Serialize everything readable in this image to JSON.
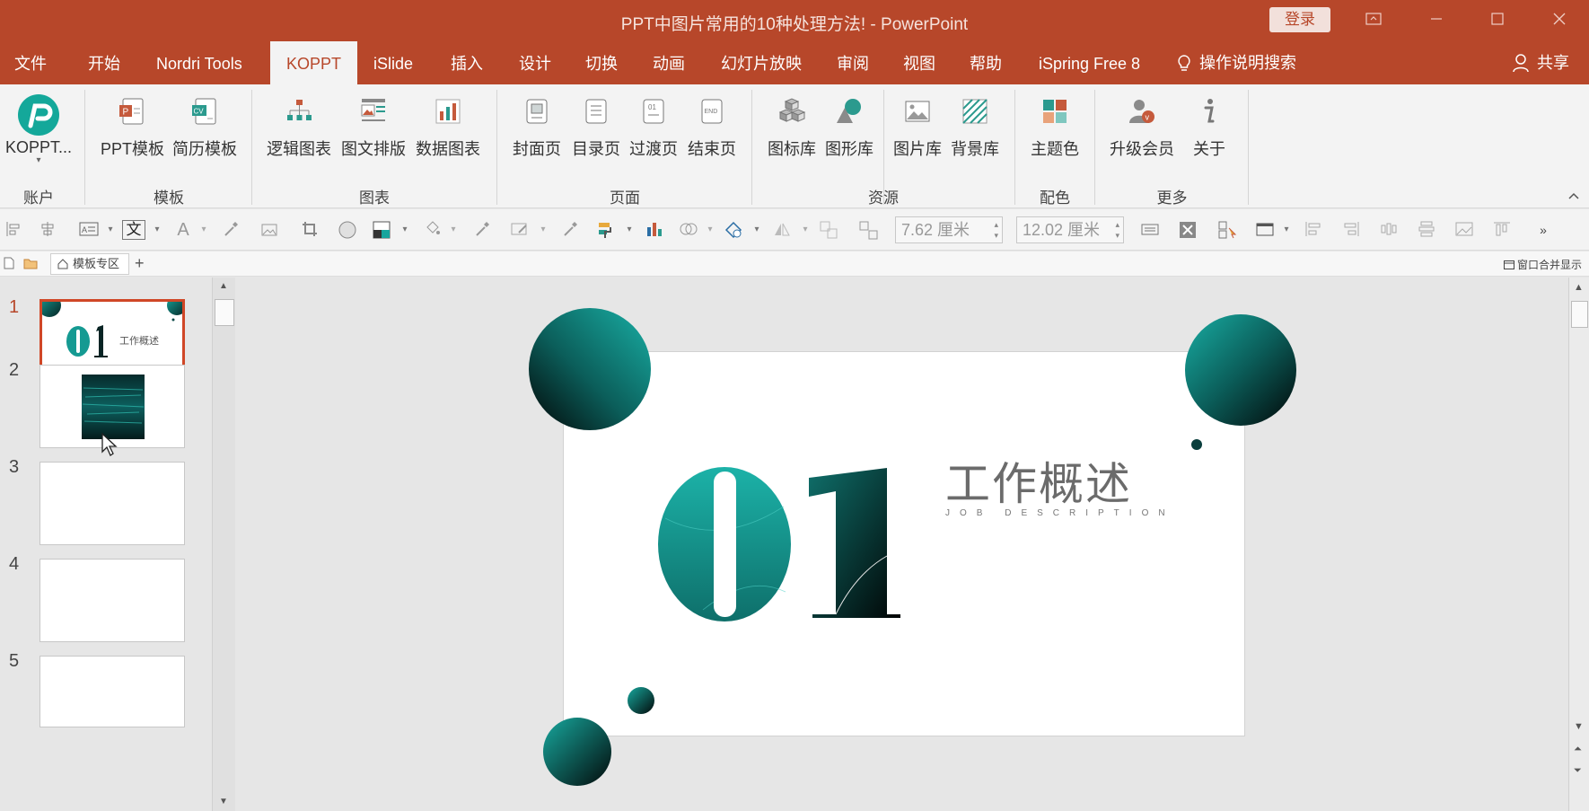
{
  "window": {
    "title": "PPT中图片常用的10种处理方法!  -  PowerPoint",
    "login_label": "登录"
  },
  "tabs": [
    {
      "label": "文件"
    },
    {
      "label": "开始"
    },
    {
      "label": "Nordri Tools"
    },
    {
      "label": "KOPPT",
      "active": true
    },
    {
      "label": "iSlide"
    },
    {
      "label": "插入"
    },
    {
      "label": "设计"
    },
    {
      "label": "切换"
    },
    {
      "label": "动画"
    },
    {
      "label": "幻灯片放映"
    },
    {
      "label": "审阅"
    },
    {
      "label": "视图"
    },
    {
      "label": "帮助"
    },
    {
      "label": "iSpring Free 8"
    }
  ],
  "search_label": "操作说明搜索",
  "share_label": "共享",
  "ribbon": {
    "buttons": [
      {
        "label": "KOPPT...",
        "icon": "koppt-logo-icon"
      },
      {
        "label": "PPT模板",
        "icon": "ppt-template-icon"
      },
      {
        "label": "简历模板",
        "icon": "cv-template-icon"
      },
      {
        "label": "逻辑图表",
        "icon": "logic-chart-icon"
      },
      {
        "label": "图文排版",
        "icon": "layout-icon"
      },
      {
        "label": "数据图表",
        "icon": "data-chart-icon"
      },
      {
        "label": "封面页",
        "icon": "cover-page-icon"
      },
      {
        "label": "目录页",
        "icon": "toc-page-icon"
      },
      {
        "label": "过渡页",
        "icon": "transition-page-icon"
      },
      {
        "label": "结束页",
        "icon": "end-page-icon"
      },
      {
        "label": "图标库",
        "icon": "icon-library-icon"
      },
      {
        "label": "图形库",
        "icon": "shape-library-icon"
      },
      {
        "label": "图片库",
        "icon": "picture-library-icon"
      },
      {
        "label": "背景库",
        "icon": "background-library-icon"
      },
      {
        "label": "主题色",
        "icon": "theme-color-icon"
      },
      {
        "label": "升级会员",
        "icon": "vip-icon"
      },
      {
        "label": "关于",
        "icon": "info-icon"
      }
    ],
    "groups": [
      "账户",
      "模板",
      "图表",
      "页面",
      "资源",
      "配色",
      "更多"
    ]
  },
  "toolbar": {
    "height_value": "7.62 厘米",
    "width_value": "12.02 厘米",
    "text_glyph": "文",
    "font_glyph": "A"
  },
  "docbar": {
    "tab_label": "模板专区",
    "merge_label": "窗口合并显示"
  },
  "thumbnails": [
    {
      "number": "1"
    },
    {
      "number": "2"
    },
    {
      "number": "3"
    },
    {
      "number": "4"
    },
    {
      "number": "5"
    }
  ],
  "slide": {
    "number_text": "01",
    "title": "工作概述",
    "subtitle": "JOB DESCRIPTION",
    "thumb_number_text": "01",
    "thumb_title": "工作概述",
    "thumb_subtitle": "JOB DESCRIPTION"
  },
  "colors": {
    "accent": "#b7472a",
    "teal": "#17a59d",
    "dark": "#050a0a"
  }
}
